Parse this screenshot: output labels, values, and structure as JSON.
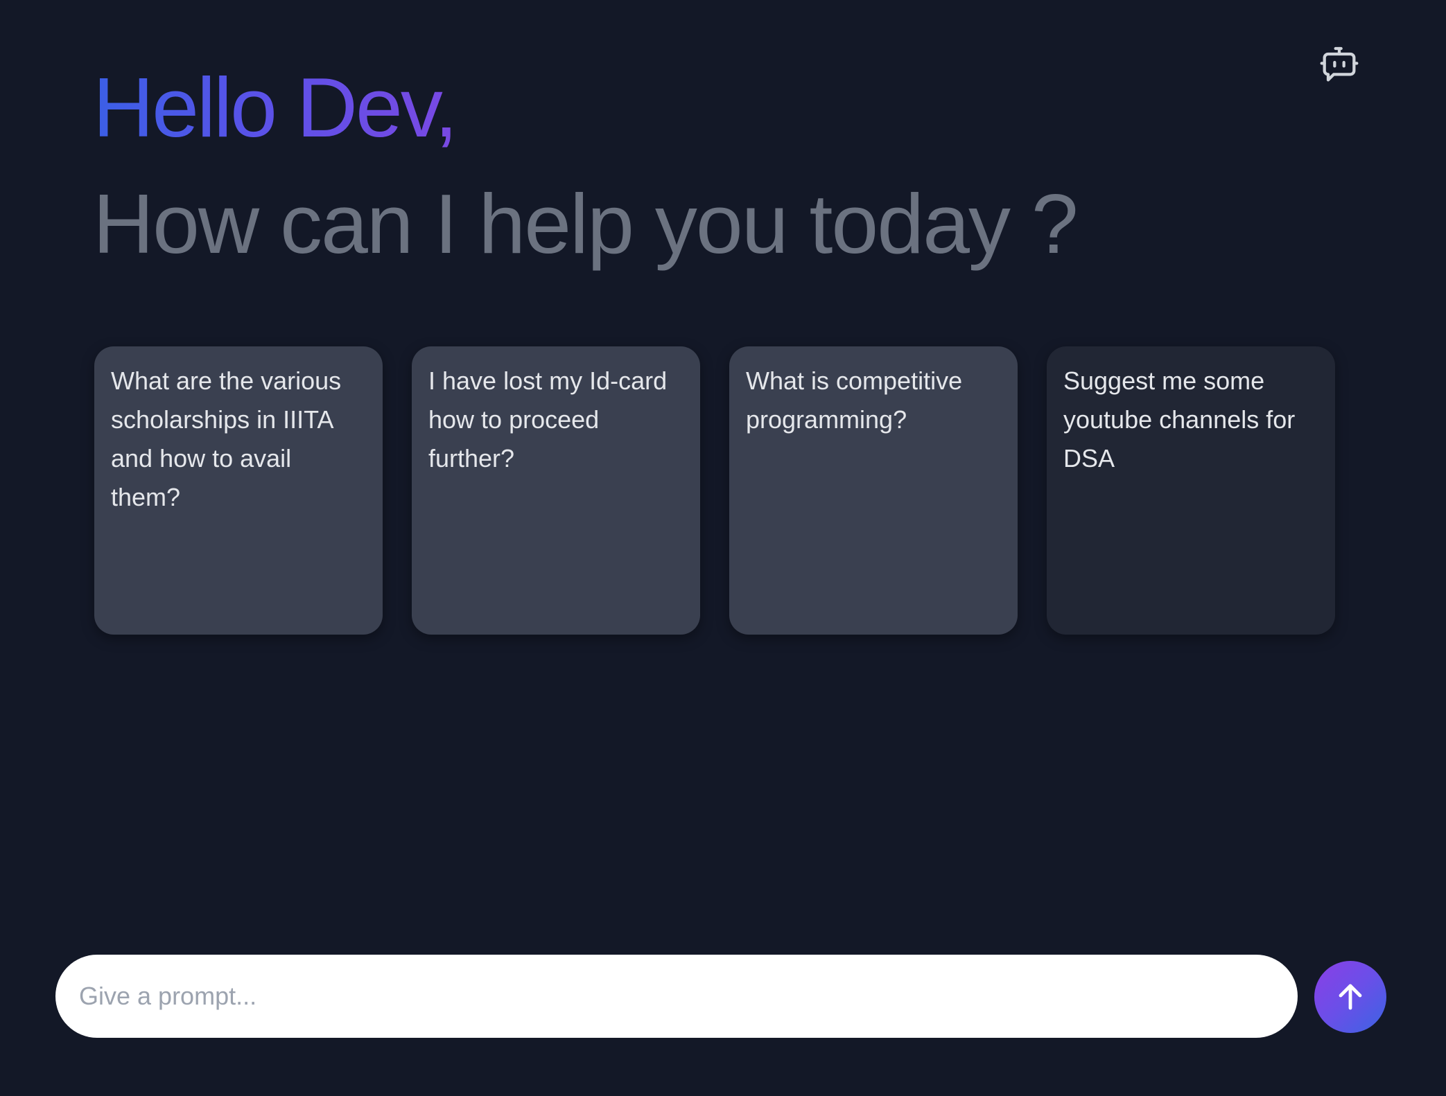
{
  "header": {
    "greeting": "Hello Dev,",
    "subheading": "How can I help you today ?",
    "bot_icon": "chatbot-icon"
  },
  "suggestions": [
    {
      "text": "What are the various scholarships in IIITA and how to avail them?"
    },
    {
      "text": "I have lost my Id-card how to proceed further?"
    },
    {
      "text": "What is competitive programming?"
    },
    {
      "text": "Suggest me some youtube channels for DSA"
    }
  ],
  "prompt": {
    "placeholder": "Give a prompt...",
    "value": "",
    "send_icon": "arrow-up-icon"
  },
  "colors": {
    "background": "#131827",
    "card": "#3a4050",
    "card_dark": "#212634",
    "accent_start": "#3b5fe6",
    "accent_end": "#7a49e3"
  }
}
